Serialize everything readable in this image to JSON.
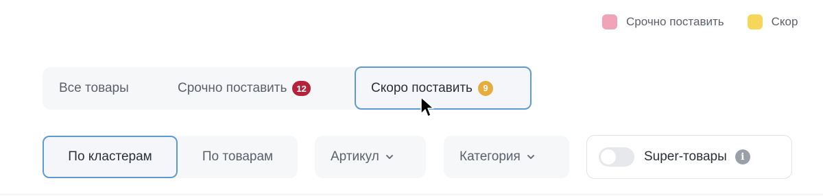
{
  "legend": {
    "items": [
      {
        "label": "Срочно поставить",
        "color": "#f1a3b8"
      },
      {
        "label": "Скор",
        "color": "#f6d75b"
      }
    ]
  },
  "tabs": {
    "all": {
      "label": "Все товары"
    },
    "urgent": {
      "label": "Срочно поставить",
      "count": "12",
      "badge_color": "#b5223a"
    },
    "soon": {
      "label": "Скоро поставить",
      "count": "9",
      "badge_color": "#e6ad3c"
    },
    "selected": "soon"
  },
  "filters": {
    "view_mode": {
      "options": [
        "По кластерам",
        "По товарам"
      ],
      "selected": "По кластерам"
    },
    "article_dropdown": {
      "label": "Артикул",
      "icon": "chevron-down-icon"
    },
    "category_dropdown": {
      "label": "Категория",
      "icon": "chevron-down-icon"
    },
    "super_products": {
      "label": "Super-товары",
      "enabled": false,
      "info_icon": "info-icon",
      "info_symbol": "i"
    }
  },
  "colors": {
    "accent_border": "#5b9ad6",
    "panel_bg": "#f6f7f9"
  }
}
